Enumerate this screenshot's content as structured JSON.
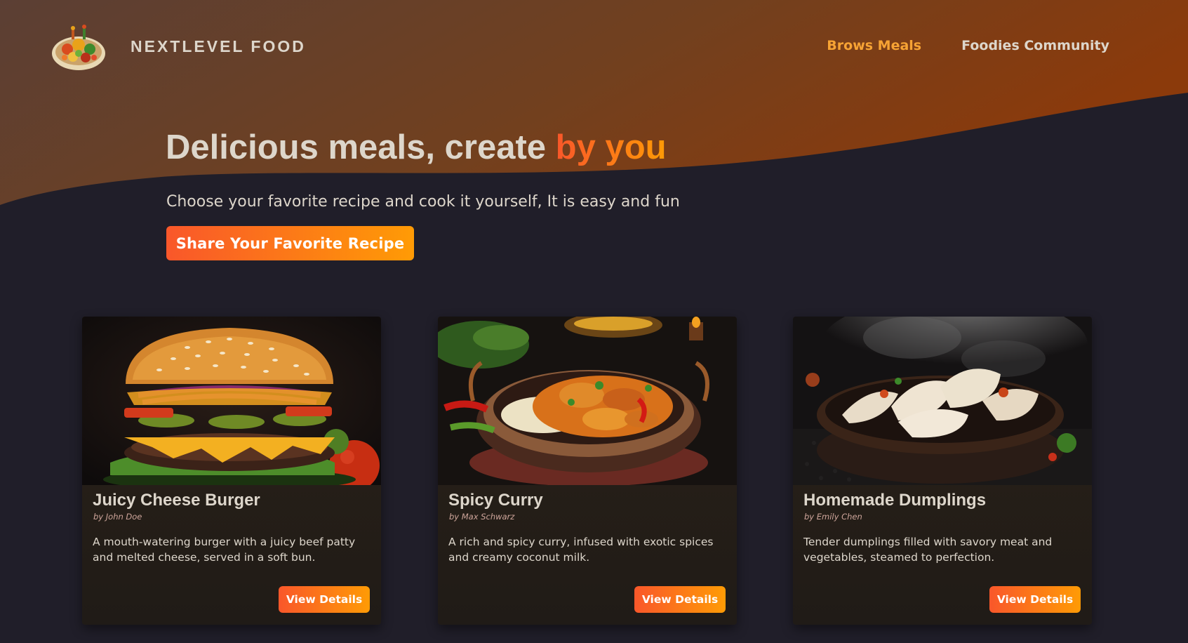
{
  "header": {
    "logo_text": "NEXTLEVEL FOOD",
    "nav": [
      {
        "label": "Brows Meals",
        "active": true
      },
      {
        "label": "Foodies Community",
        "active": false
      }
    ]
  },
  "hero": {
    "title_main": "Delicious meals, create ",
    "title_accent": "by you",
    "subtitle": "Choose your favorite recipe and cook it yourself, It is easy and fun",
    "cta_label": "Share Your Favorite Recipe"
  },
  "meals": [
    {
      "title": "Juicy Cheese Burger",
      "author": "by John Doe",
      "description": "A mouth-watering burger with a juicy beef patty and melted cheese, served in a soft bun.",
      "button_label": "View Details",
      "image_icon": "burger-photo"
    },
    {
      "title": "Spicy Curry",
      "author": "by Max Schwarz",
      "description": "A rich and spicy curry, infused with exotic spices and creamy coconut milk.",
      "button_label": "View Details",
      "image_icon": "curry-photo"
    },
    {
      "title": "Homemade Dumplings",
      "author": "by Emily Chen",
      "description": "Tender dumplings filled with savory meat and vegetables, steamed to perfection.",
      "button_label": "View Details",
      "image_icon": "dumplings-photo"
    }
  ],
  "colors": {
    "background": "#201e29",
    "header_gradient_start": "#5b3f34",
    "header_gradient_end": "#8b3a0b",
    "accent_start": "#f9572a",
    "accent_end": "#ff9b05",
    "nav_active": "#f7a334",
    "text": "#ddd6cb"
  }
}
